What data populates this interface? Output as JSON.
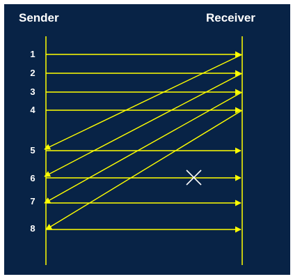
{
  "sender_label": "Sender",
  "receiver_label": "Receiver",
  "sequence_numbers": [
    "1",
    "2",
    "3",
    "4",
    "5",
    "6",
    "7",
    "8"
  ],
  "colors": {
    "background": "#082346",
    "line": "#ffff00",
    "lost_marker": "#ffffff",
    "text": "#ffffff"
  }
}
